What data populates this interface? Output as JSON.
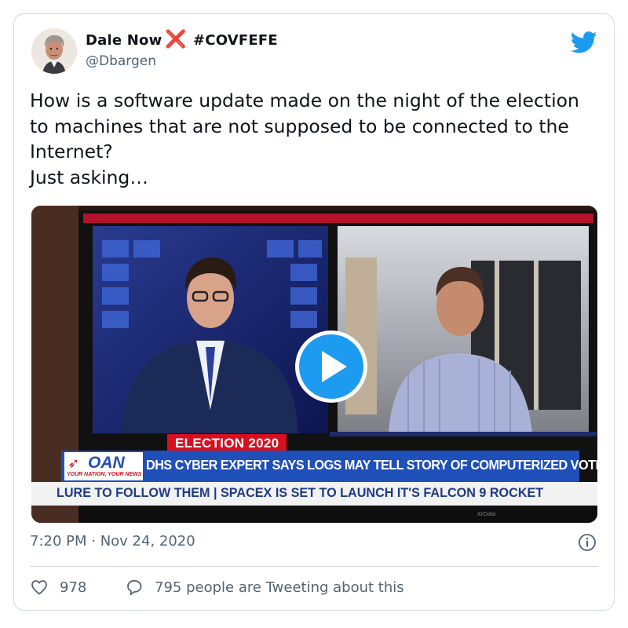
{
  "author": {
    "name": "Dale Now",
    "name_emoji": "❌",
    "hashtag": "#COVFEFE",
    "handle": "@Dbargen"
  },
  "tweet": {
    "text": "How is a software update made on the night of the election to machines that are not supposed to be connected to the Internet?\nJust asking…",
    "timestamp": "7:20 PM · Nov 24, 2020"
  },
  "video": {
    "tag": "ELECTION 2020",
    "network_logo": "OAN",
    "network_slogan": "YOUR NATION, YOUR NEWS",
    "headline": "DHS CYBER EXPERT SAYS LOGS MAY TELL STORY OF COMPUTERIZED VOTE FRAUD",
    "ticker": "LURE TO FOLLOW THEM  |  SPACEX IS SET TO LAUNCH IT'S FALCON 9 ROCKET",
    "tv_brand": "XrColor"
  },
  "stats": {
    "likes": "978",
    "conversation": "795 people are Tweeting about this"
  },
  "icons": {
    "brand": "twitter-bird-icon",
    "play": "play-icon",
    "info": "info-icon",
    "like": "heart-icon",
    "reply": "speech-bubble-icon"
  },
  "colors": {
    "twitter_blue": "#1d9bf0",
    "text": "#0f1419",
    "secondary_text": "#536471",
    "border": "#cfd9de",
    "oan_red": "#d7101f",
    "oan_blue": "#1f4fb8"
  }
}
